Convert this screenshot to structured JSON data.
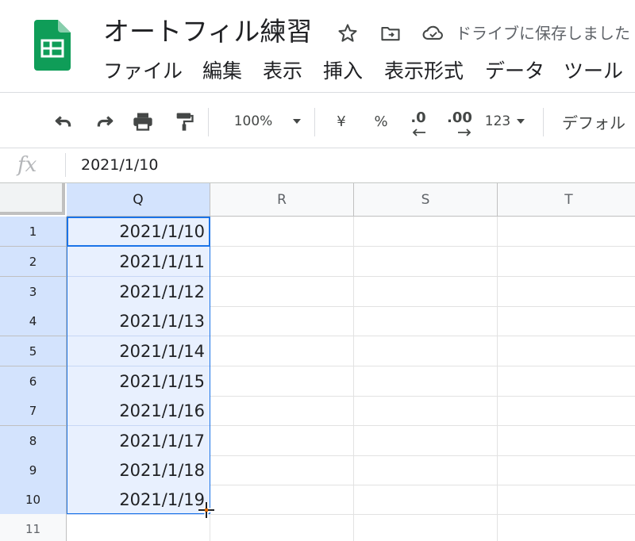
{
  "document": {
    "title": "オートフィル練習",
    "save_status": "ドライブに保存しました"
  },
  "menu": [
    "ファイル",
    "編集",
    "表示",
    "挿入",
    "表示形式",
    "データ",
    "ツール"
  ],
  "toolbar": {
    "zoom": "100%",
    "currency": "¥",
    "percent": "%",
    "decrease_decimal": ".0",
    "increase_decimal": ".00",
    "more_formats": "123",
    "font": "デフォル"
  },
  "formula_bar": {
    "icon_label": "fx",
    "value": "2021/1/10"
  },
  "columns": [
    "Q",
    "R",
    "S",
    "T"
  ],
  "rows": [
    "1",
    "2",
    "3",
    "4",
    "5",
    "6",
    "7",
    "8",
    "9",
    "10",
    "11"
  ],
  "column_q_values": [
    "2021/1/10",
    "2021/1/11",
    "2021/1/12",
    "2021/1/13",
    "2021/1/14",
    "2021/1/15",
    "2021/1/16",
    "2021/1/17",
    "2021/1/18",
    "2021/1/19",
    ""
  ],
  "colors": {
    "accent": "#1a73e8",
    "selection_fill": "#e8f0fe",
    "sheets_green": "#0f9d58"
  }
}
